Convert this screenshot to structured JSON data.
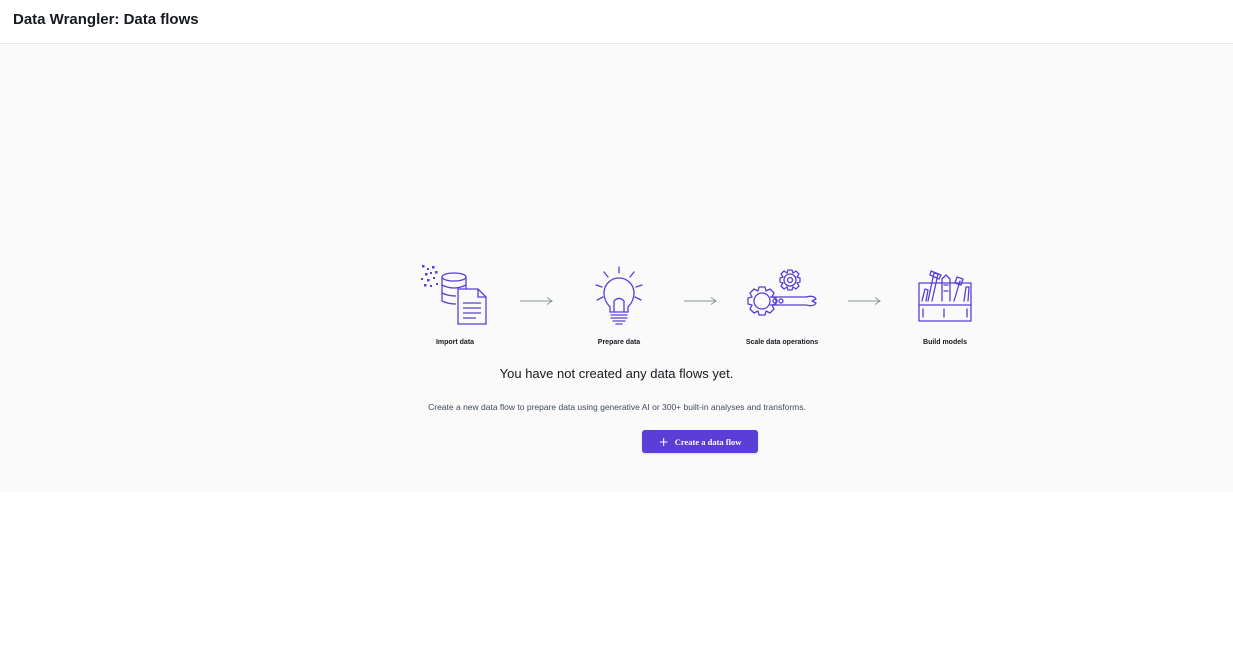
{
  "header": {
    "title": "Data Wrangler: Data flows"
  },
  "steps": [
    {
      "label": "Import data",
      "icon": "import-data-icon"
    },
    {
      "label": "Prepare data",
      "icon": "lightbulb-icon"
    },
    {
      "label": "Scale data operations",
      "icon": "gears-wrench-icon"
    },
    {
      "label": "Build models",
      "icon": "toolbox-icon"
    }
  ],
  "empty_state": {
    "title": "You have not created any data flows yet.",
    "description": "Create a new data flow to prepare data using generative AI or 300+ built-in analyses and transforms.",
    "button_label": "Create a data flow",
    "button_icon": "plus-icon"
  },
  "colors": {
    "accent": "#5a3ed6",
    "icon": "#5a3ed6",
    "panel_background": "#fafafa"
  }
}
